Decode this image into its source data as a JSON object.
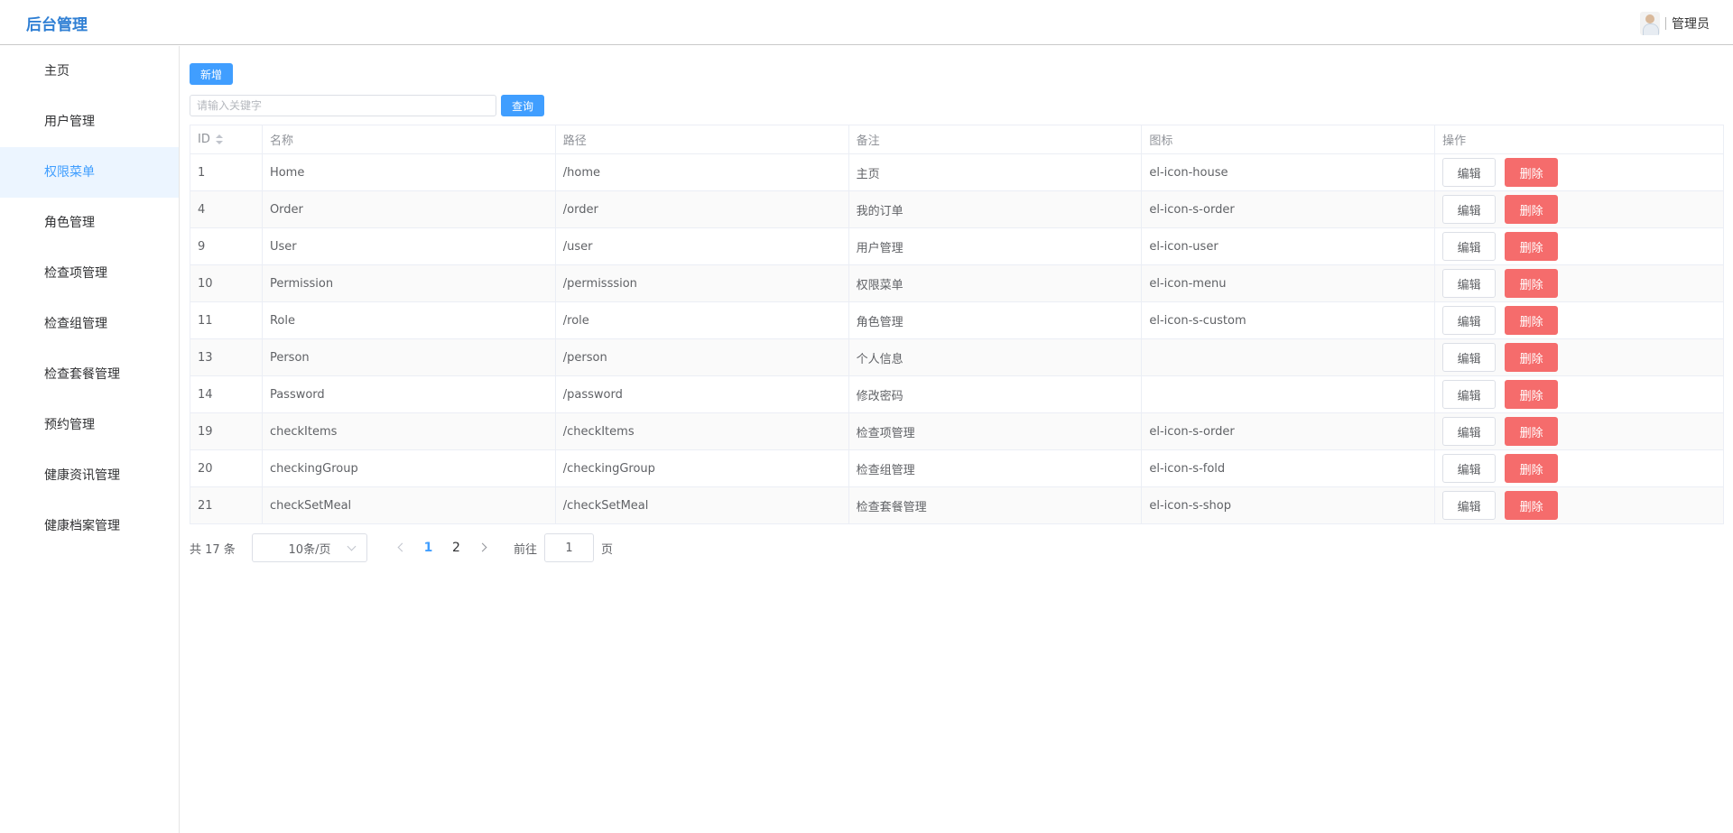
{
  "header": {
    "title": "后台管理",
    "user_name": "管理员"
  },
  "sidebar": {
    "items": [
      {
        "label": "主页"
      },
      {
        "label": "用户管理"
      },
      {
        "label": "权限菜单"
      },
      {
        "label": "角色管理"
      },
      {
        "label": "检查项管理"
      },
      {
        "label": "检查组管理"
      },
      {
        "label": "检查套餐管理"
      },
      {
        "label": "预约管理"
      },
      {
        "label": "健康资讯管理"
      },
      {
        "label": "健康档案管理"
      }
    ],
    "active_index": 2
  },
  "toolbar": {
    "add_label": "新增",
    "search_placeholder": "请输入关键字",
    "search_label": "查询"
  },
  "table": {
    "columns": [
      "ID",
      "名称",
      "路径",
      "备注",
      "图标",
      "操作"
    ],
    "edit_label": "编辑",
    "delete_label": "删除",
    "rows": [
      {
        "id": "1",
        "name": "Home",
        "path": "/home",
        "note": "主页",
        "icon": "el-icon-house"
      },
      {
        "id": "4",
        "name": "Order",
        "path": "/order",
        "note": "我的订单",
        "icon": "el-icon-s-order"
      },
      {
        "id": "9",
        "name": "User",
        "path": "/user",
        "note": "用户管理",
        "icon": "el-icon-user"
      },
      {
        "id": "10",
        "name": "Permission",
        "path": "/permisssion",
        "note": "权限菜单",
        "icon": "el-icon-menu"
      },
      {
        "id": "11",
        "name": "Role",
        "path": "/role",
        "note": "角色管理",
        "icon": "el-icon-s-custom"
      },
      {
        "id": "13",
        "name": "Person",
        "path": "/person",
        "note": "个人信息",
        "icon": ""
      },
      {
        "id": "14",
        "name": "Password",
        "path": "/password",
        "note": "修改密码",
        "icon": ""
      },
      {
        "id": "19",
        "name": "checkItems",
        "path": "/checkItems",
        "note": "检查项管理",
        "icon": "el-icon-s-order"
      },
      {
        "id": "20",
        "name": "checkingGroup",
        "path": "/checkingGroup",
        "note": "检查组管理",
        "icon": "el-icon-s-fold"
      },
      {
        "id": "21",
        "name": "checkSetMeal",
        "path": "/checkSetMeal",
        "note": "检查套餐管理",
        "icon": "el-icon-s-shop"
      }
    ]
  },
  "pagination": {
    "total_text": "共 17 条",
    "page_size": "10条/页",
    "pages": [
      "1",
      "2"
    ],
    "current_page": "1",
    "goto_label": "前往",
    "goto_value": "1",
    "goto_suffix": "页"
  },
  "colors": {
    "primary": "#409eff",
    "danger": "#f56c6c",
    "brand": "#2f7fd4",
    "active_bg": "#ecf5ff"
  }
}
